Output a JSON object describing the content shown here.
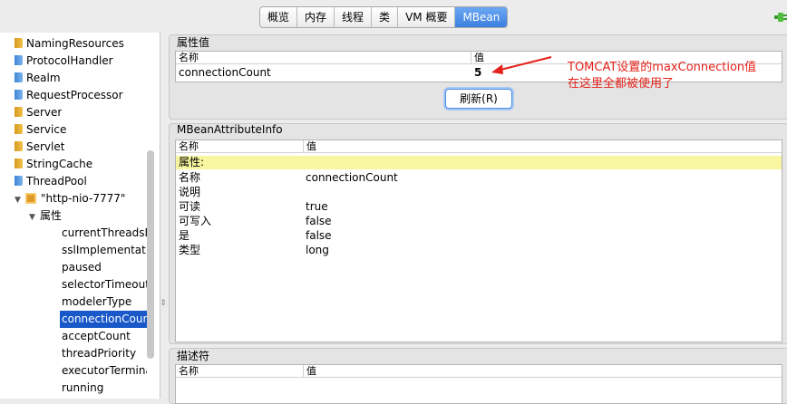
{
  "tabs": [
    {
      "label": "概览",
      "active": false
    },
    {
      "label": "内存",
      "active": false
    },
    {
      "label": "线程",
      "active": false
    },
    {
      "label": "类",
      "active": false
    },
    {
      "label": "VM 概要",
      "active": false
    },
    {
      "label": "MBean",
      "active": true
    }
  ],
  "tree": {
    "items": [
      {
        "label": "NamingResources",
        "icon": "folder-orange-icon"
      },
      {
        "label": "ProtocolHandler",
        "icon": "folder-blue-icon"
      },
      {
        "label": "Realm",
        "icon": "folder-blue-icon"
      },
      {
        "label": "RequestProcessor",
        "icon": "folder-blue-icon"
      },
      {
        "label": "Server",
        "icon": "folder-orange-icon"
      },
      {
        "label": "Service",
        "icon": "folder-orange-icon"
      },
      {
        "label": "Servlet",
        "icon": "folder-orange-icon"
      },
      {
        "label": "StringCache",
        "icon": "folder-orange-icon"
      },
      {
        "label": "ThreadPool",
        "icon": "folder-blue-icon"
      },
      {
        "label": "\"http-nio-7777\"",
        "icon": "bean-icon"
      },
      {
        "label": "属性",
        "icon": "expanded-triangle-icon"
      },
      {
        "label": "currentThreadsBusy"
      },
      {
        "label": "sslImplementationName"
      },
      {
        "label": "paused"
      },
      {
        "label": "selectorTimeout"
      },
      {
        "label": "modelerType"
      },
      {
        "label": "connectionCount",
        "selected": true
      },
      {
        "label": "acceptCount"
      },
      {
        "label": "threadPriority"
      },
      {
        "label": "executorTerminationTimeoutMillis"
      },
      {
        "label": "running"
      }
    ]
  },
  "attribute_value": {
    "title": "属性值",
    "col_name": "名称",
    "col_value": "值",
    "name": "connectionCount",
    "value": "5",
    "refresh_label": "刷新(R)"
  },
  "annotation": {
    "line1": "TOMCAT设置的maxConnection值",
    "line2": "在这里全都被使用了",
    "color": "#e4221b"
  },
  "mbean_info": {
    "title": "MBeanAttributeInfo",
    "col_name": "名称",
    "col_value": "值",
    "section_label": "属性:",
    "rows": [
      {
        "name": "名称",
        "value": "connectionCount"
      },
      {
        "name": "说明",
        "value": ""
      },
      {
        "name": "可读",
        "value": "true"
      },
      {
        "name": "可写入",
        "value": "false"
      },
      {
        "name": "是",
        "value": "false"
      },
      {
        "name": "类型",
        "value": "long"
      }
    ]
  },
  "descriptor": {
    "title": "描述符",
    "col_name": "名称",
    "col_value": "值"
  },
  "colors": {
    "selection": "#1858c8",
    "active_tab": "#3d7fe0",
    "highlight_row": "#f8f7a0"
  }
}
